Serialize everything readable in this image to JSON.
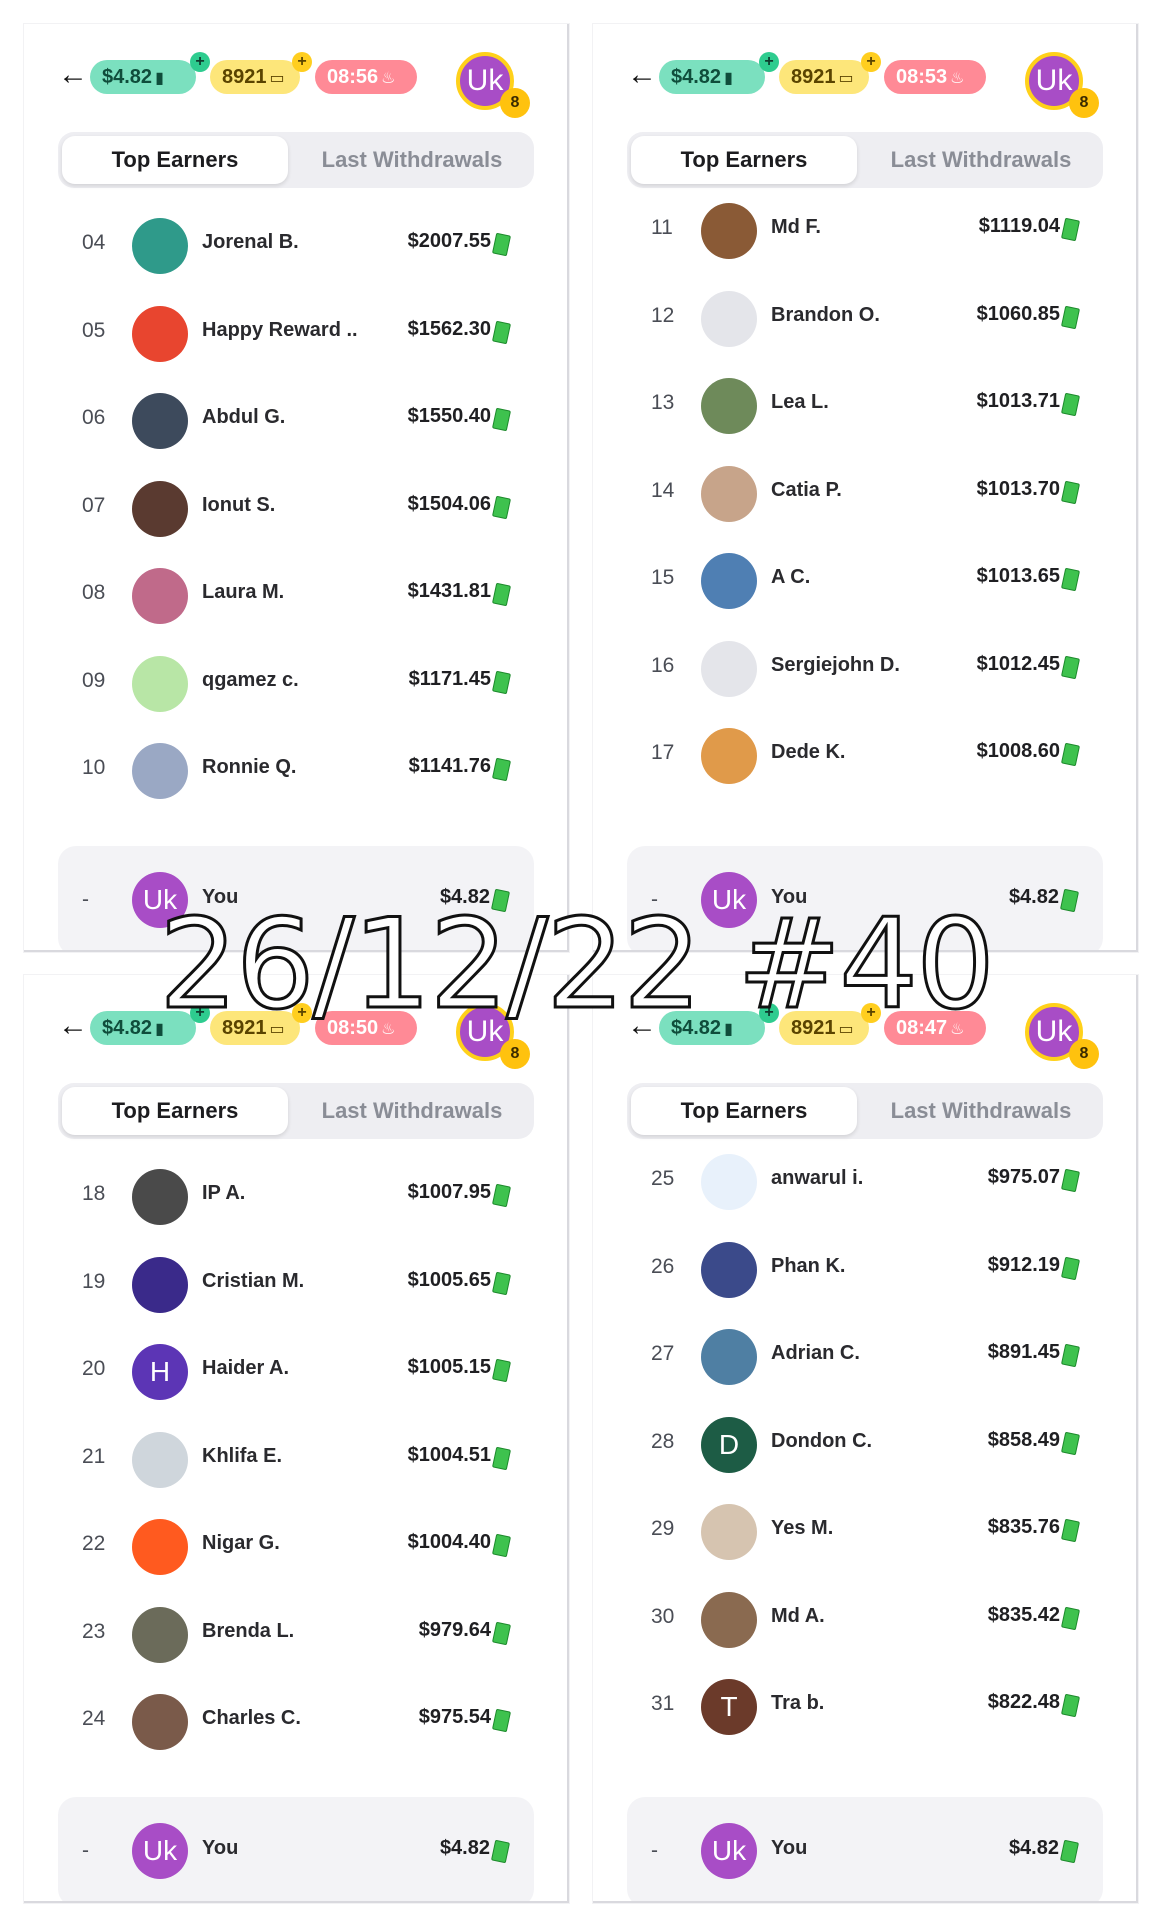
{
  "header": {
    "cash_balance": "$4.82",
    "tickets": "8921",
    "plus": "+",
    "profile_initials": "Uk",
    "level": "8"
  },
  "tabs": {
    "top_earners": "Top Earners",
    "last_withdrawals": "Last Withdrawals"
  },
  "current_user": {
    "rank": "-",
    "initials": "Uk",
    "name": "You",
    "amount": "$4.82"
  },
  "caption": "26/12/22 #40",
  "panels": [
    {
      "timer": "08:56",
      "rows": [
        {
          "rank": "04",
          "name": "Jorenal B.",
          "amount": "$2007.55",
          "avatar_color": "#2f9a8a",
          "initial": ""
        },
        {
          "rank": "05",
          "name": "Happy Reward ..",
          "amount": "$1562.30",
          "avatar_color": "#e8452f",
          "initial": ""
        },
        {
          "rank": "06",
          "name": "Abdul G.",
          "amount": "$1550.40",
          "avatar_color": "#3d4a5c",
          "initial": ""
        },
        {
          "rank": "07",
          "name": "Ionut S.",
          "amount": "$1504.06",
          "avatar_color": "#5a3a30",
          "initial": ""
        },
        {
          "rank": "08",
          "name": "Laura M.",
          "amount": "$1431.81",
          "avatar_color": "#c06a8a",
          "initial": ""
        },
        {
          "rank": "09",
          "name": "qgamez c.",
          "amount": "$1171.45",
          "avatar_color": "#b8e6a6",
          "initial": ""
        },
        {
          "rank": "10",
          "name": "Ronnie Q.",
          "amount": "$1141.76",
          "avatar_color": "#9aa8c4",
          "initial": ""
        }
      ]
    },
    {
      "timer": "08:53",
      "rows": [
        {
          "rank": "11",
          "name": "Md F.",
          "amount": "$1119.04",
          "avatar_color": "#8a5a36",
          "initial": ""
        },
        {
          "rank": "12",
          "name": "Brandon O.",
          "amount": "$1060.85",
          "avatar_color": "#e4e5ea",
          "initial": ""
        },
        {
          "rank": "13",
          "name": "Lea L.",
          "amount": "$1013.71",
          "avatar_color": "#6e8a5a",
          "initial": ""
        },
        {
          "rank": "14",
          "name": "Catia P.",
          "amount": "$1013.70",
          "avatar_color": "#c7a48a",
          "initial": ""
        },
        {
          "rank": "15",
          "name": "A C.",
          "amount": "$1013.65",
          "avatar_color": "#4f7fb3",
          "initial": ""
        },
        {
          "rank": "16",
          "name": "Sergiejohn D.",
          "amount": "$1012.45",
          "avatar_color": "#e4e5ea",
          "initial": ""
        },
        {
          "rank": "17",
          "name": "Dede K.",
          "amount": "$1008.60",
          "avatar_color": "#e09a4a",
          "initial": ""
        }
      ]
    },
    {
      "timer": "08:50",
      "rows": [
        {
          "rank": "18",
          "name": "IP A.",
          "amount": "$1007.95",
          "avatar_color": "#4a4a4a",
          "initial": ""
        },
        {
          "rank": "19",
          "name": "Cristian M.",
          "amount": "$1005.65",
          "avatar_color": "#3a2a8a",
          "initial": ""
        },
        {
          "rank": "20",
          "name": "Haider A.",
          "amount": "$1005.15",
          "avatar_color": "#5c35b5",
          "initial": "H"
        },
        {
          "rank": "21",
          "name": "Khlifa E.",
          "amount": "$1004.51",
          "avatar_color": "#cfd6dc",
          "initial": ""
        },
        {
          "rank": "22",
          "name": "Nigar G.",
          "amount": "$1004.40",
          "avatar_color": "#ff5a1f",
          "initial": ""
        },
        {
          "rank": "23",
          "name": "Brenda L.",
          "amount": "$979.64",
          "avatar_color": "#6b6b5a",
          "initial": ""
        },
        {
          "rank": "24",
          "name": "Charles C.",
          "amount": "$975.54",
          "avatar_color": "#7a5a4a",
          "initial": ""
        }
      ]
    },
    {
      "timer": "08:47",
      "rows": [
        {
          "rank": "25",
          "name": "anwarul i.",
          "amount": "$975.07",
          "avatar_color": "#e8f1fb",
          "initial": ""
        },
        {
          "rank": "26",
          "name": "Phan K.",
          "amount": "$912.19",
          "avatar_color": "#3b4a8a",
          "initial": ""
        },
        {
          "rank": "27",
          "name": "Adrian C.",
          "amount": "$891.45",
          "avatar_color": "#4f7fa3",
          "initial": ""
        },
        {
          "rank": "28",
          "name": "Dondon C.",
          "amount": "$858.49",
          "avatar_color": "#1d5c45",
          "initial": "D"
        },
        {
          "rank": "29",
          "name": "Yes M.",
          "amount": "$835.76",
          "avatar_color": "#d6c4b0",
          "initial": ""
        },
        {
          "rank": "30",
          "name": "Md A.",
          "amount": "$835.42",
          "avatar_color": "#8a6a50",
          "initial": ""
        },
        {
          "rank": "31",
          "name": "Tra b.",
          "amount": "$822.48",
          "avatar_color": "#6b3a2a",
          "initial": "T"
        }
      ]
    }
  ]
}
